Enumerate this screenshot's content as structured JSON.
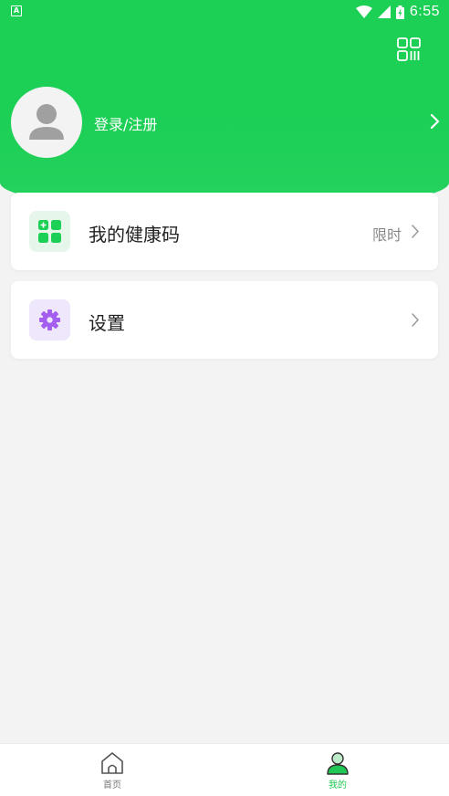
{
  "status_bar": {
    "app_icon_letter": "A",
    "time": "6:55"
  },
  "profile": {
    "login_label": "登录/注册"
  },
  "menu": {
    "health_code": {
      "label": "我的健康码",
      "tag": "限时"
    },
    "settings": {
      "label": "设置"
    }
  },
  "tabbar": {
    "home_label": "首页",
    "mine_label": "我的"
  },
  "colors": {
    "primary_green": "#1ccf55",
    "tab_active": "#1fc853",
    "settings_purple": "#a45ef0"
  },
  "icons": [
    "wifi-icon",
    "signal-icon",
    "battery-icon",
    "scan-icon",
    "avatar-icon",
    "chevron-right-icon",
    "health-code-icon",
    "gear-icon",
    "home-icon",
    "user-icon"
  ]
}
